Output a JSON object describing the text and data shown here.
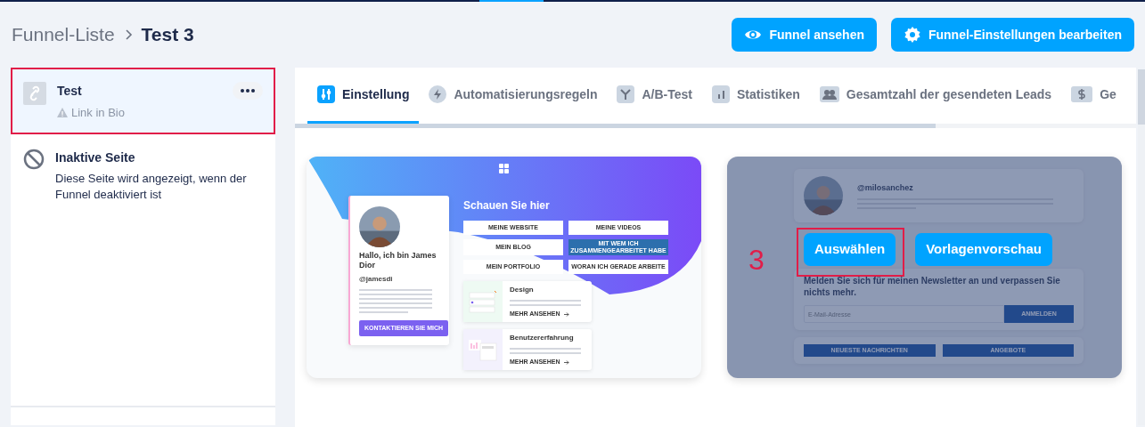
{
  "breadcrumb": [
    {
      "label": "Funnel-Liste",
      "current": false
    },
    {
      "label": "Test 3",
      "current": true
    }
  ],
  "actions": [
    {
      "label": "Funnel ansehen"
    },
    {
      "label": "Funnel-Einstellungen bearbeiten"
    }
  ],
  "pages": [
    {
      "kind": "page",
      "title": "Test",
      "subtitle": "Link in Bio",
      "selected": true,
      "highlighted": true
    },
    {
      "kind": "inactive",
      "title": "Inaktive Seite",
      "description": "Diese Seite wird angezeigt, wenn der Funnel deaktiviert ist",
      "selected": false,
      "highlighted": false
    }
  ],
  "tabs": [
    {
      "label": "Einstellung",
      "selected": true
    },
    {
      "label": "Automatisierungsregeln",
      "selected": false
    },
    {
      "label": "A/B-Test",
      "selected": false
    },
    {
      "label": "Statistiken",
      "selected": false
    },
    {
      "label": "Gesamtzahl der gesendeten Leads",
      "selected": false
    },
    {
      "label": "Ge",
      "selected": false
    }
  ],
  "templates": [
    {
      "kind": "bio",
      "hovered": false,
      "heading": "Schauen Sie hier",
      "links": [
        {
          "label": "MEINE WEBSITE",
          "selected": false
        },
        {
          "label": "MEINE VIDEOS",
          "selected": false
        },
        {
          "label": "MEIN BLOG",
          "selected": false
        },
        {
          "label": "MIT WEM ICH ZUSAMMENGEARBEITET HABE",
          "selected": true
        },
        {
          "label": "MEIN PORTFOLIO",
          "selected": false
        },
        {
          "label": "WORAN ICH GERADE ARBEITE",
          "selected": false
        }
      ],
      "profile": {
        "name": "Hallo, ich bin James Dior",
        "handle": "@jamesdi",
        "button": "KONTAKTIEREN SIE MICH"
      },
      "services": [
        {
          "title": "Design",
          "link": "MEHR ANSEHEN"
        },
        {
          "title": "Benutzererfahrung",
          "link": "MEHR ANSEHEN"
        }
      ]
    },
    {
      "kind": "newsletter",
      "hovered": true,
      "annotation": "3",
      "profile": {
        "handle": "@milosanchez"
      },
      "newsletter": {
        "heading": "Melden Sie sich für meinen Newsletter an und verpassen Sie nichts mehr.",
        "placeholder": "E-Mail-Adresse",
        "button": "ANMELDEN"
      },
      "links": [
        "NEUESTE NACHRICHTEN",
        "ANGEBOTE"
      ],
      "overlay_buttons": [
        {
          "label": "Auswählen",
          "highlighted": true
        },
        {
          "label": "Vorlagenvorschau",
          "highlighted": false
        }
      ]
    }
  ]
}
